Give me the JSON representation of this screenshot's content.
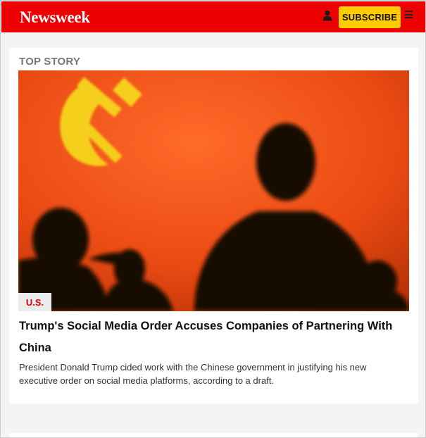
{
  "header": {
    "logo": "Newsweek",
    "subscribe_label": "SUBSCRIBE",
    "brand_color": "#ee0000",
    "subscribe_color": "#ffcc00",
    "icons": [
      "user-icon",
      "menu-icon"
    ]
  },
  "top_story": {
    "section_label": "TOP STORY",
    "category": "U.S.",
    "headline": "Trump's Social Media Order Accuses Companies of Partnering With China",
    "summary": "President Donald Trump cided work with the Chinese government in justifying his new executive order on social media platforms, according to a draft."
  }
}
